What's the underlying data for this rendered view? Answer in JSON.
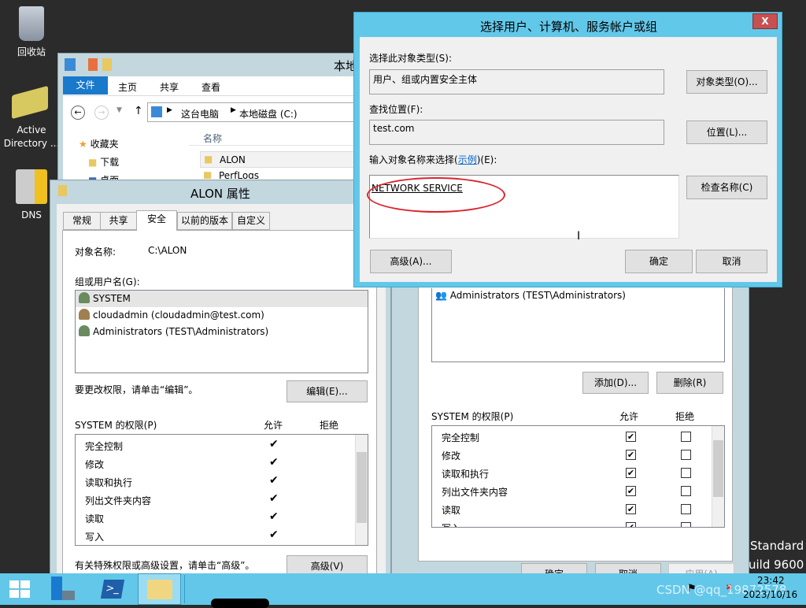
{
  "desktop": {
    "icons": [
      {
        "label": "回收站",
        "icon": "recycle-bin-icon"
      },
      {
        "label": "Active Directory ...",
        "icon": "active-directory-icon"
      },
      {
        "label": "DNS",
        "icon": "dns-icon"
      }
    ],
    "watermark": [
      "Standard",
      "uild 9600"
    ]
  },
  "explorer": {
    "title": "本地",
    "ribbon_tabs": [
      "文件",
      "主页",
      "共享",
      "查看"
    ],
    "breadcrumb": [
      "这台电脑",
      "本地磁盘 (C:)"
    ],
    "nav": [
      "收藏夹",
      "下载",
      "桌面"
    ],
    "column": "名称",
    "files": [
      "ALON",
      "PerfLogs"
    ]
  },
  "props": {
    "title": "ALON 属性",
    "tabs": [
      "常规",
      "共享",
      "安全",
      "以前的版本",
      "自定义"
    ],
    "object_label": "对象名称:",
    "object_value": "C:\\ALON",
    "group_label": "组或用户名(G):",
    "users": [
      "SYSTEM",
      "cloudadmin (cloudadmin@test.com)",
      "Administrators (TEST\\Administrators)"
    ],
    "edit_hint": "要更改权限，请单击“编辑”。",
    "edit_button": "编辑(E)...",
    "perm_label": "SYSTEM 的权限(P)",
    "allow": "允许",
    "deny": "拒绝",
    "perms": [
      "完全控制",
      "修改",
      "读取和执行",
      "列出文件夹内容",
      "读取",
      "写入"
    ],
    "adv_hint": "有关特殊权限或高级设置，请单击“高级”。",
    "adv_button": "高级(V)"
  },
  "props2": {
    "users": [
      "Administrators (TEST\\Administrators)"
    ],
    "add_button": "添加(D)...",
    "remove_button": "删除(R)",
    "perm_label": "SYSTEM 的权限(P)",
    "allow": "允许",
    "deny": "拒绝",
    "perms": [
      "完全控制",
      "修改",
      "读取和执行",
      "列出文件夹内容",
      "读取",
      "写入"
    ],
    "ok": "确定",
    "cancel": "取消",
    "apply": "应用(A)"
  },
  "select": {
    "title": "选择用户、计算机、服务帐户或组",
    "type_label": "选择此对象类型(S):",
    "type_value": "用户、组或内置安全主体",
    "type_button": "对象类型(O)...",
    "loc_label": "查找位置(F):",
    "loc_value": "test.com",
    "loc_button": "位置(L)...",
    "name_label_a": "输入对象名称来选择(",
    "name_label_link": "示例",
    "name_label_b": ")(E):",
    "name_value": "NETWORK SERVICE",
    "check_button": "检查名称(C)",
    "adv_button": "高级(A)...",
    "ok": "确定",
    "cancel": "取消",
    "close": "X",
    "highlight_color": "#d9232e"
  },
  "taskbar": {
    "time": "23:42",
    "date": "2023/10/16",
    "watermark": "CSDN @qq_19872578",
    "color": "#63c7e9"
  }
}
